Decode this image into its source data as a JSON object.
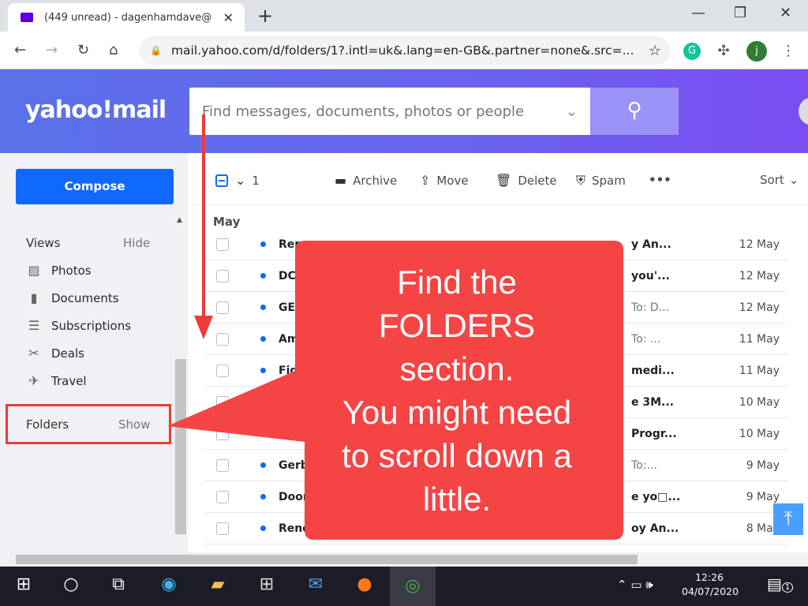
{
  "browser": {
    "tab_title": "(449 unread) - dagenhamdave@",
    "url": "mail.yahoo.com/d/folders/1?.intl=uk&.lang=en-GB&.partner=none&.src=...",
    "profile_initial": "j",
    "grammarly": "G"
  },
  "header": {
    "logo": "yahoo!mail",
    "search_placeholder": "Find messages, documents, photos or people"
  },
  "sidebar": {
    "compose": "Compose",
    "views_label": "Views",
    "views_toggle": "Hide",
    "items": [
      {
        "label": "Photos",
        "icon": "photo-icon"
      },
      {
        "label": "Documents",
        "icon": "document-icon"
      },
      {
        "label": "Subscriptions",
        "icon": "subscriptions-icon"
      },
      {
        "label": "Deals",
        "icon": "scissors-icon"
      },
      {
        "label": "Travel",
        "icon": "plane-icon"
      }
    ],
    "folders_label": "Folders",
    "folders_toggle": "Show"
  },
  "toolbar": {
    "selected_count": "1",
    "archive": "Archive",
    "move": "Move",
    "delete": "Delete",
    "spam": "Spam",
    "more": "•••",
    "sort": "Sort"
  },
  "list": {
    "group": "May",
    "rows": [
      {
        "sender": "Ren",
        "subject": "y An...",
        "date": "12 May"
      },
      {
        "sender": "DCL",
        "subject": "you'...",
        "date": "12 May"
      },
      {
        "sender": "GEIC",
        "to": "To: D...",
        "date": "12 May"
      },
      {
        "sender": "Ame",
        "to": "To: ...",
        "date": "11 May"
      },
      {
        "sender": "Fide",
        "subject": "medi...",
        "date": "11 May"
      },
      {
        "sender": "",
        "subject": "e 3M...",
        "date": "10 May"
      },
      {
        "sender": "",
        "subject": "Progr...",
        "date": "10 May"
      },
      {
        "sender": "Gerb",
        "to": "To:...",
        "date": "9 May"
      },
      {
        "sender": "Door",
        "subject": "e yo□...",
        "date": "9 May"
      },
      {
        "sender": "Renew",
        "subject": "oy An...",
        "date": "8 May"
      }
    ]
  },
  "callout": {
    "lines": [
      "Find the",
      "FOLDERS",
      "section.",
      "You might need",
      "to scroll down a",
      "little."
    ],
    "color": "#f44444"
  },
  "taskbar": {
    "time": "12:26",
    "date": "04/07/2020",
    "notifications": "1"
  }
}
